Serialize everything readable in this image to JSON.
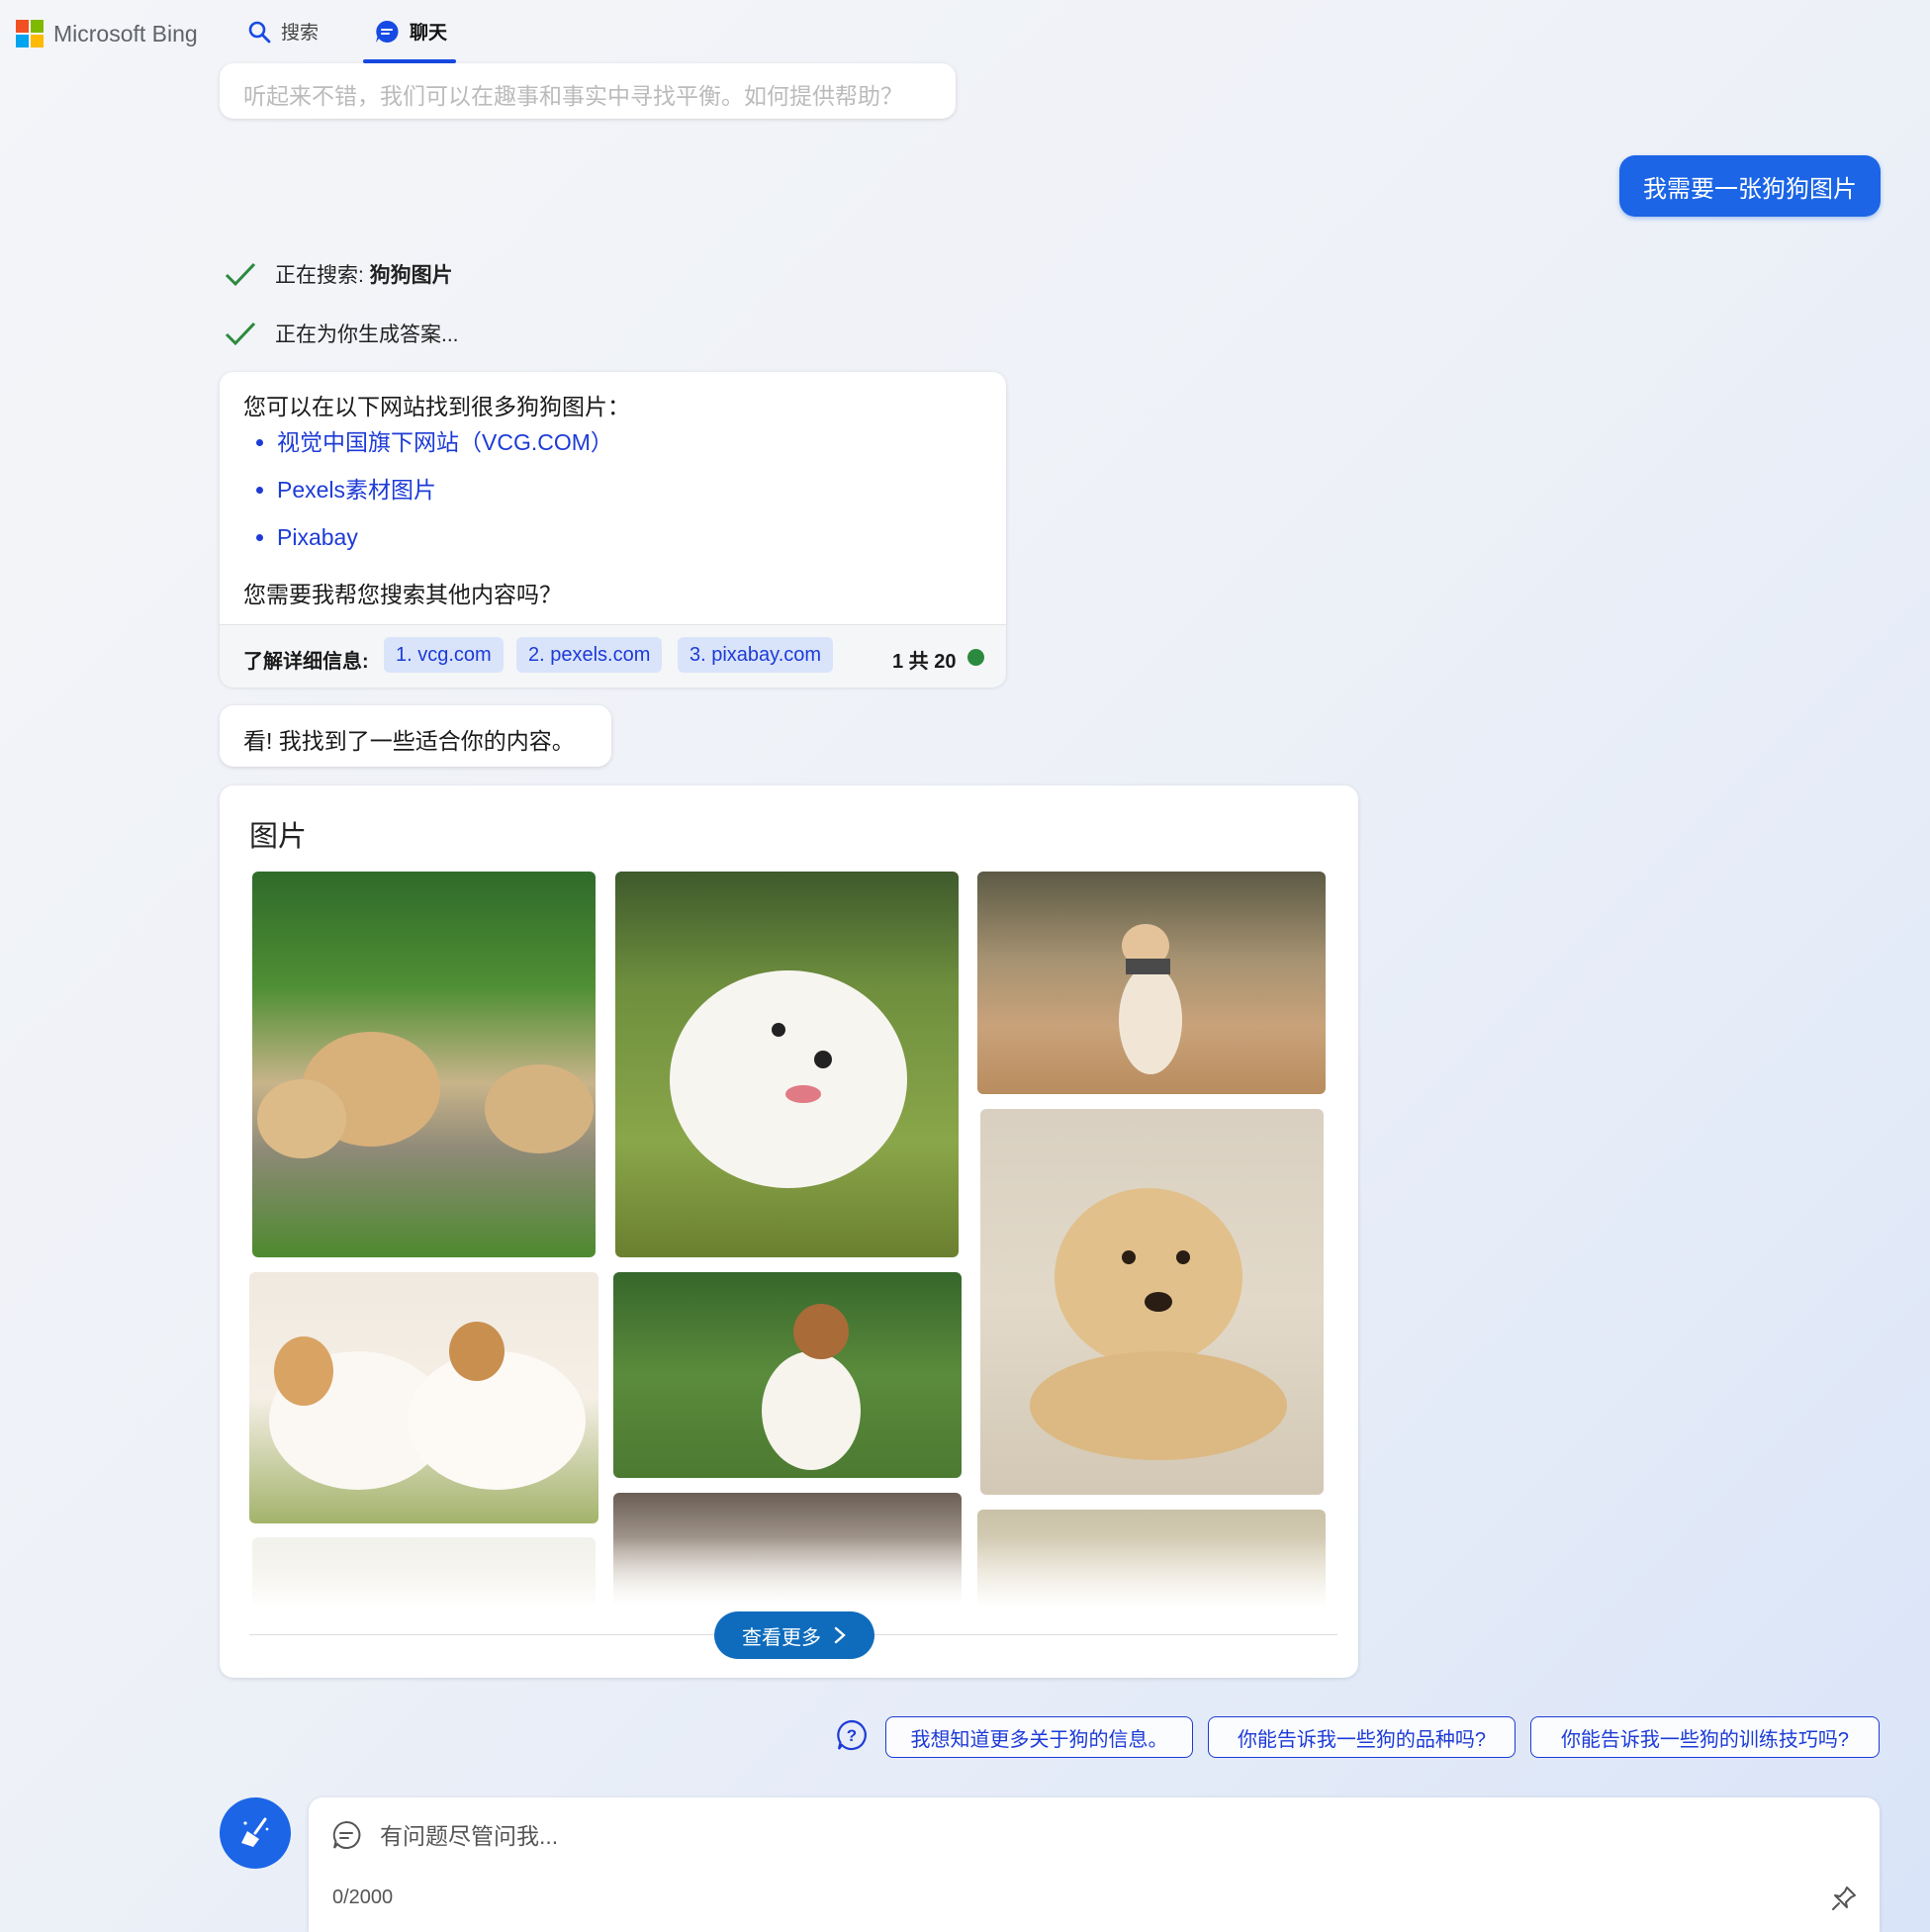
{
  "header": {
    "brand": "Microsoft Bing",
    "tabs": [
      {
        "label": "搜索",
        "active": false
      },
      {
        "label": "聊天",
        "active": true
      }
    ]
  },
  "conversation": {
    "previous_message": "听起来不错，我们可以在趣事和事实中寻找平衡。如何提供帮助？",
    "user_message": "我需要一张狗狗图片",
    "status": [
      {
        "prefix": "正在搜索: ",
        "bold": "狗狗图片"
      },
      {
        "prefix": "正在为你生成答案...",
        "bold": ""
      }
    ],
    "answer": {
      "intro": "您可以在以下网站找到很多狗狗图片：",
      "links": [
        "视觉中国旗下网站（VCG.COM）",
        "Pexels素材图片",
        "Pixabay"
      ],
      "outro": "您需要我帮您搜索其他内容吗？",
      "learn_more_label": "了解详细信息:",
      "sources": [
        "1. vcg.com",
        "2. pexels.com",
        "3. pixabay.com"
      ],
      "turn_count": "1 共 20"
    },
    "look_message": "看! 我找到了一些适合你的内容。",
    "images": {
      "title": "图片",
      "see_more": "查看更多"
    }
  },
  "suggestions": [
    "我想知道更多关于狗的信息。",
    "你能告诉我一些狗的品种吗?",
    "你能告诉我一些狗的训练技巧吗?"
  ],
  "composer": {
    "placeholder": "有问题尽管问我...",
    "counter": "0/2000"
  },
  "colors": {
    "accent": "#1b65e6",
    "link": "#1d3bd6",
    "see_more_bg": "#0f6cbd",
    "status_check": "#2b8a3e"
  }
}
